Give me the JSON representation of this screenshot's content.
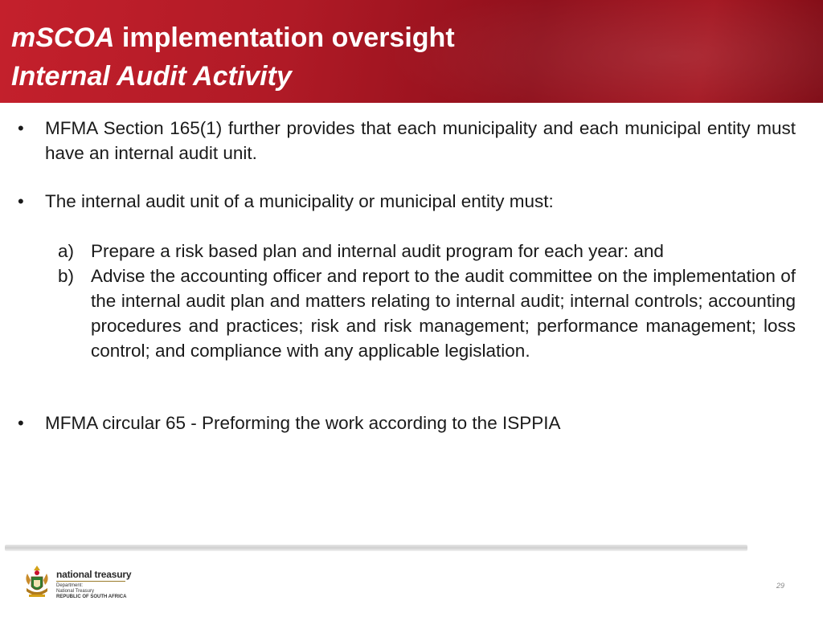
{
  "header": {
    "title_part1": "mSCOA",
    "title_part2": " implementation oversight",
    "subtitle": "Internal Audit Activity"
  },
  "content": {
    "bullet_char": "•",
    "bullets": [
      "MFMA Section 165(1) further provides that each municipality and each municipal entity must have an internal audit unit.",
      "The internal audit unit of a municipality or municipal entity must:",
      "MFMA circular 65 - Preforming the work according to the ISPPIA"
    ],
    "subitems": [
      {
        "marker": "a)",
        "text": "Prepare a risk based plan and internal audit program for each year: and"
      },
      {
        "marker": "b)",
        "text": "Advise the accounting officer and report to the audit committee on the implementation of the internal audit plan and matters relating to internal audit; internal controls; accounting procedures and practices; risk and risk management; performance management; loss control; and compliance with any applicable legislation."
      }
    ]
  },
  "footer": {
    "logo_name": "national treasury",
    "dept_line1": "Department:",
    "dept_line2": "National Treasury",
    "dept_line3": "REPUBLIC OF SOUTH AFRICA",
    "page_number": "29"
  },
  "colors": {
    "header_red": "#b01a26",
    "header_dark": "#7e0a14",
    "text": "#1a1a1a"
  }
}
